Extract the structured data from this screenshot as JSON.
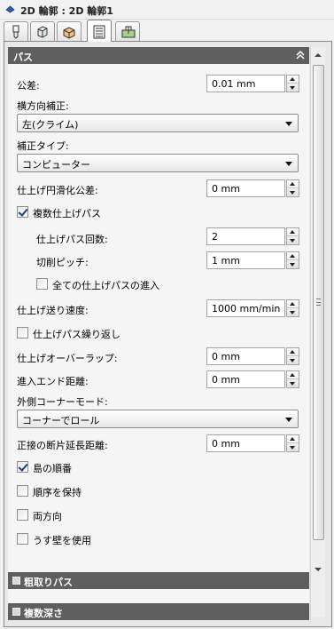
{
  "window": {
    "title": "2D 輪郭 : 2D 輪郭1"
  },
  "tabs": [
    {
      "icon": "tool-icon",
      "active": false
    },
    {
      "icon": "stock-icon",
      "active": false
    },
    {
      "icon": "setup-icon",
      "active": false
    },
    {
      "icon": "passes-icon",
      "active": true
    },
    {
      "icon": "linking-icon",
      "active": false
    }
  ],
  "sections": {
    "passes": {
      "title": "パス",
      "expanded": true
    },
    "roughing": {
      "title": "粗取りパス",
      "expanded": false
    },
    "multiple_depths": {
      "title": "複数深さ",
      "expanded": false
    }
  },
  "fields": {
    "tolerance": {
      "label": "公差:",
      "value": "0.01 mm"
    },
    "side_compensation": {
      "label": "横方向補正:",
      "value": "左(クライム)"
    },
    "compensation_type": {
      "label": "補正タイプ:",
      "value": "コンピューター"
    },
    "finishing_smoothing_tolerance": {
      "label": "仕上げ円滑化公差:",
      "value": "0 mm"
    },
    "multiple_finishing_passes": {
      "label": "複数仕上げパス",
      "checked": true
    },
    "finishing_pass_count": {
      "label": "仕上げパス回数:",
      "value": "2"
    },
    "stepover": {
      "label": "切削ピッチ:",
      "value": "1 mm"
    },
    "lead_all_finishing": {
      "label": "全ての仕上げパスの進入",
      "checked": false
    },
    "finishing_feedrate": {
      "label": "仕上げ送り速度:",
      "value": "1000 mm/min"
    },
    "repeat_finishing_pass": {
      "label": "仕上げパス繰り返し",
      "checked": false
    },
    "finishing_overlap": {
      "label": "仕上げオーバーラップ:",
      "value": "0 mm"
    },
    "lead_end_distance": {
      "label": "進入エンド距離:",
      "value": "0 mm"
    },
    "outer_corner_mode": {
      "label": "外側コーナーモード:",
      "value": "コーナーでロール"
    },
    "tangential_extension": {
      "label": "正接の断片延長距離:",
      "value": "0 mm"
    },
    "island_order": {
      "label": "島の順番",
      "checked": true
    },
    "preserve_order": {
      "label": "順序を保持",
      "checked": false
    },
    "both_ways": {
      "label": "両方向",
      "checked": false
    },
    "thin_wall": {
      "label": "うす壁を使用",
      "checked": false
    }
  },
  "colors": {
    "section_header": "#5f5f5f",
    "check_mark": "#1b3c8a"
  }
}
